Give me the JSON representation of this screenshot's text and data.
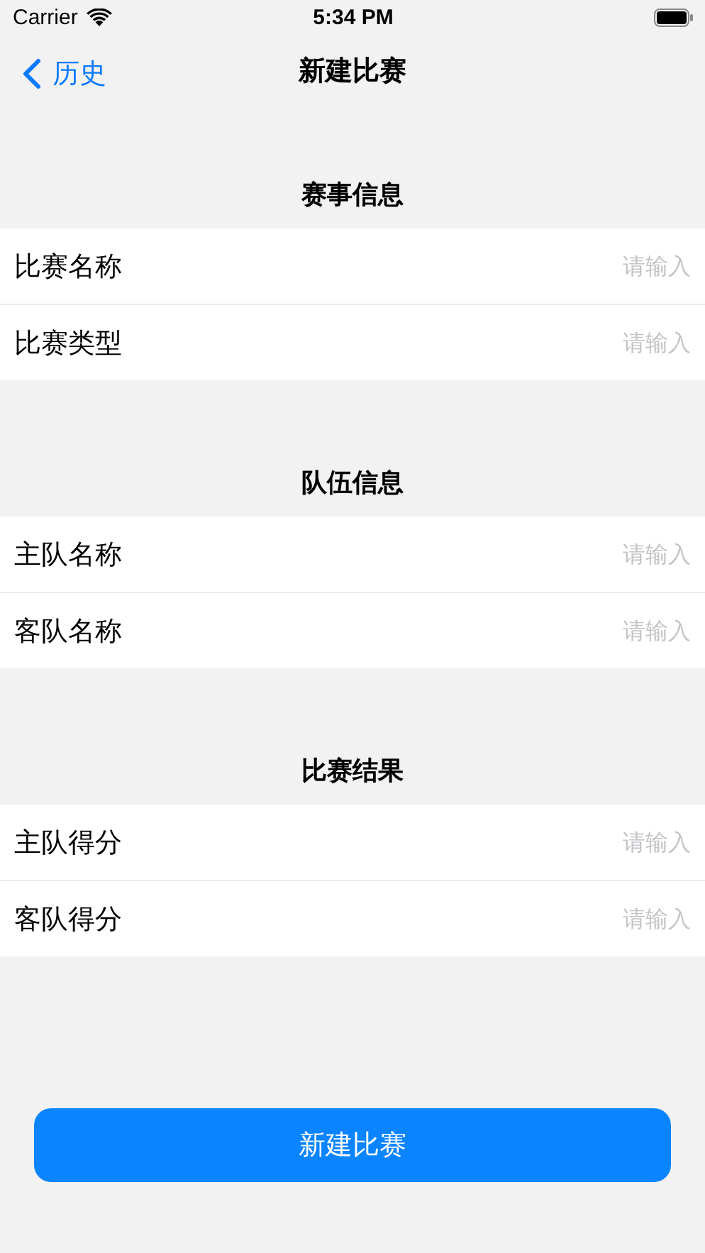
{
  "status_bar": {
    "carrier": "Carrier",
    "time": "5:34 PM"
  },
  "nav": {
    "back_label": "历史",
    "title": "新建比赛"
  },
  "sections": [
    {
      "header": "赛事信息",
      "fields": [
        {
          "label": "比赛名称",
          "placeholder": "请输入"
        },
        {
          "label": "比赛类型",
          "placeholder": "请输入"
        }
      ]
    },
    {
      "header": "队伍信息",
      "fields": [
        {
          "label": "主队名称",
          "placeholder": "请输入"
        },
        {
          "label": "客队名称",
          "placeholder": "请输入"
        }
      ]
    },
    {
      "header": "比赛结果",
      "fields": [
        {
          "label": "主队得分",
          "placeholder": "请输入"
        },
        {
          "label": "客队得分",
          "placeholder": "请输入"
        }
      ]
    }
  ],
  "submit_button": "新建比赛"
}
